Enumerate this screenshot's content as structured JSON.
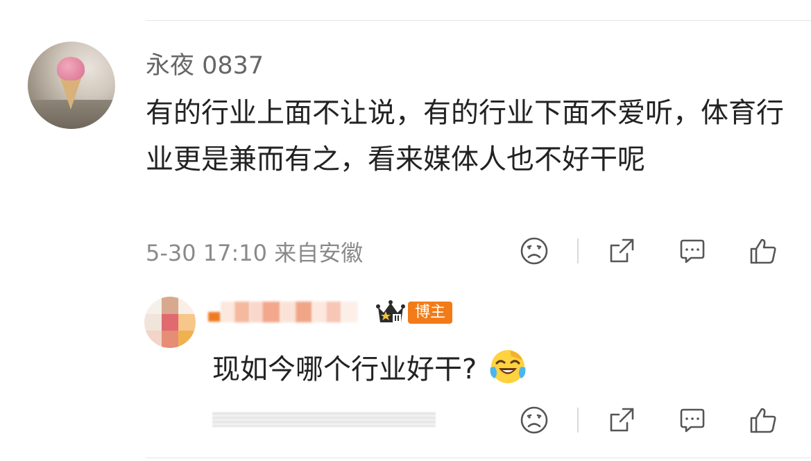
{
  "main_comment": {
    "username": "永夜 0837",
    "text": "有的行业上面不让说，有的行业下面不爱听，体育行业更是兼而有之，看来媒体人也不好干呢",
    "meta": "5-30 17:10 来自安徽",
    "actions": [
      "dislike-icon",
      "share-icon",
      "comment-icon",
      "like-icon"
    ]
  },
  "reply": {
    "badge_label": "博主",
    "text": "现如今哪个行业好干?",
    "emoji": "laughing-tears-emoji",
    "actions": [
      "dislike-icon",
      "share-icon",
      "comment-icon",
      "like-icon"
    ]
  },
  "colors": {
    "text_primary": "#222222",
    "text_secondary": "#8a8a8a",
    "username": "#666666",
    "badge_bg": "#f27b18",
    "divider": "#e6e6e6"
  }
}
